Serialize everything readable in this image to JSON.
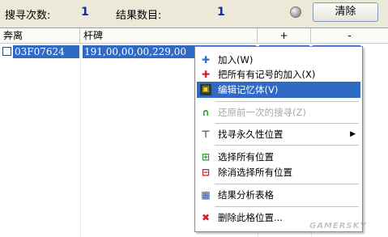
{
  "top": {
    "search_count_label": "搜寻次数:",
    "search_count_value": "1",
    "result_count_label": "结果数目:",
    "result_count_value": "1",
    "clear_button": "清除"
  },
  "table": {
    "columns": [
      "奔离",
      "杆碑",
      "+",
      "-"
    ],
    "rows": [
      {
        "address": "03F07624",
        "value": "191,00,00,00,229,00"
      }
    ]
  },
  "context_menu": {
    "items": [
      {
        "label": "加入(W)",
        "icon": "plus-blue-icon"
      },
      {
        "label": "把所有有记号的加入(X)",
        "icon": "plus-red-icon"
      },
      {
        "label": "编辑记忆体(V)",
        "icon": "edit-memory-icon"
      },
      {
        "label": "还原前一次的搜寻(Z)",
        "icon": "undo-icon"
      },
      {
        "label": "找寻永久性位置",
        "icon": "pin-icon"
      },
      {
        "label": "选择所有位置",
        "icon": "select-all-icon"
      },
      {
        "label": "除消选择所有位置",
        "icon": "deselect-all-icon"
      },
      {
        "label": "结果分析表格",
        "icon": "table-icon"
      },
      {
        "label": "删除此格位置...",
        "icon": "delete-icon"
      }
    ]
  },
  "watermark": "GAMERSKY",
  "colors": {
    "selection": "#316ac5",
    "number": "#1a2a9a",
    "delete": "#d42020"
  }
}
